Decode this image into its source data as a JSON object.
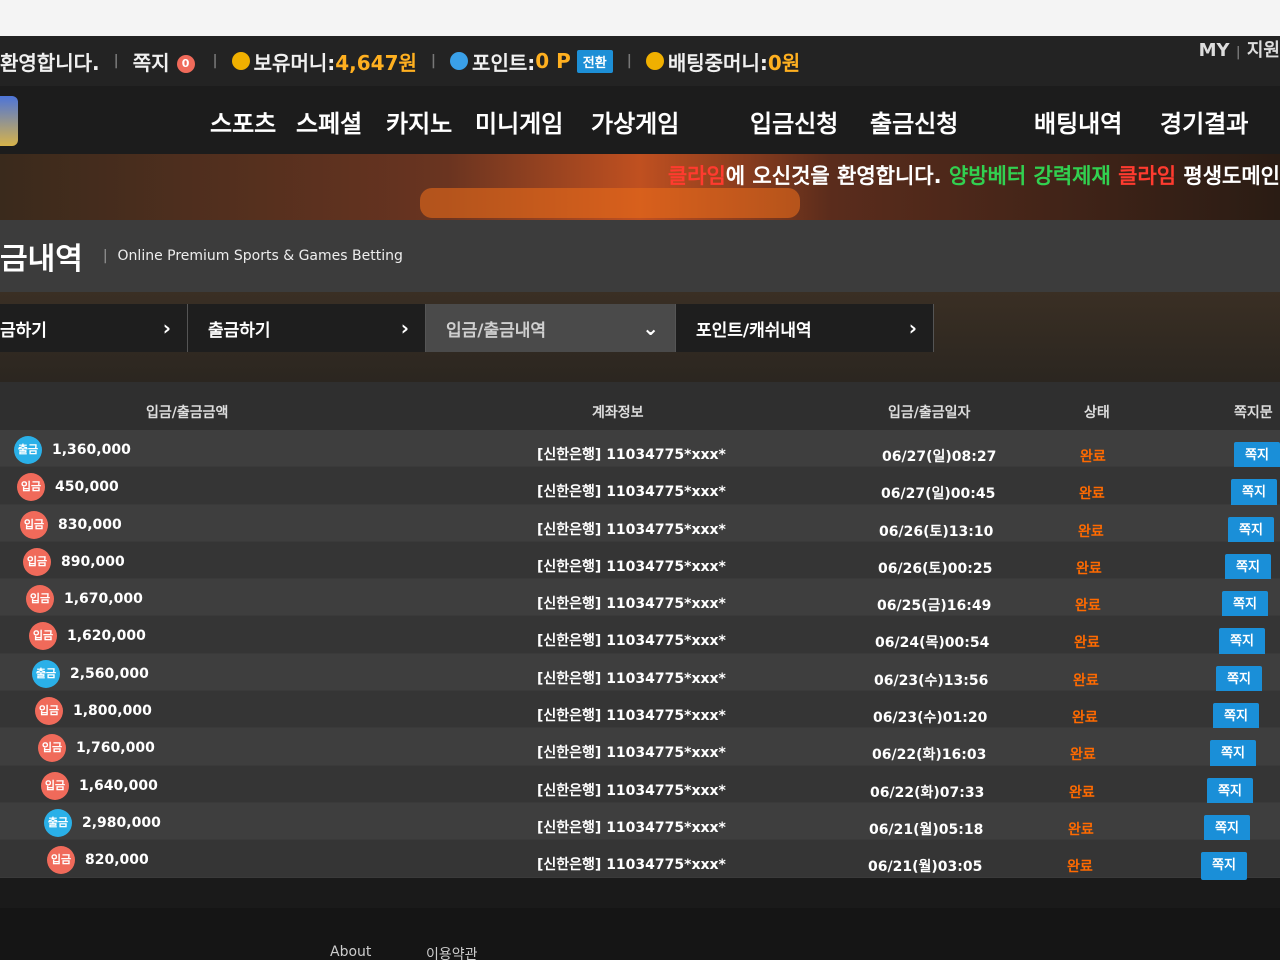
{
  "topbar": {
    "welcome": "환영합니다.",
    "message_label": "쪽지",
    "message_count": "0",
    "balance_label": "보유머니:",
    "balance_value": "4,647원",
    "point_label": "포인트:",
    "point_value": "0 P",
    "convert_label": "전환",
    "betting_label": "배팅중머니:",
    "betting_value": "0원",
    "my_label": "MY",
    "support_label": "지원"
  },
  "nav": {
    "sports": "스포츠",
    "special": "스페셜",
    "casino": "카지노",
    "minigame": "미니게임",
    "virtual": "가상게임",
    "deposit_request": "입금신청",
    "withdraw_request": "출금신청",
    "bet_history": "배팅내역",
    "results": "경기결과"
  },
  "banner": {
    "brand1": "클라임",
    "text1": "에 오신것을 환영합니다.",
    "text2": " 양방베터 강력제재 ",
    "brand2": "클라임",
    "text3": " 평생도메인"
  },
  "page": {
    "title": "금내역",
    "subtitle": "Online Premium Sports & Games Betting"
  },
  "tabs": [
    {
      "label": "금하기"
    },
    {
      "label": "출금하기"
    },
    {
      "label": "입금/출금내역"
    },
    {
      "label": "포인트/캐쉬내역"
    }
  ],
  "table": {
    "headers": {
      "amount": "입금/출금금액",
      "account": "계좌정보",
      "datetime": "입금/출금일자",
      "status": "상태",
      "message": "쪽지문"
    },
    "rows": [
      {
        "type": "출금",
        "kind": "out",
        "amount": "1,360,000",
        "account": "[신한은행] 11034775*xxx*",
        "date": "06/27(일)08:27",
        "status": "완료",
        "msg": "쪽지"
      },
      {
        "type": "입금",
        "kind": "in",
        "amount": "450,000",
        "account": "[신한은행] 11034775*xxx*",
        "date": "06/27(일)00:45",
        "status": "완료",
        "msg": "쪽지"
      },
      {
        "type": "입금",
        "kind": "in",
        "amount": "830,000",
        "account": "[신한은행] 11034775*xxx*",
        "date": "06/26(토)13:10",
        "status": "완료",
        "msg": "쪽지"
      },
      {
        "type": "입금",
        "kind": "in",
        "amount": "890,000",
        "account": "[신한은행] 11034775*xxx*",
        "date": "06/26(토)00:25",
        "status": "완료",
        "msg": "쪽지"
      },
      {
        "type": "입금",
        "kind": "in",
        "amount": "1,670,000",
        "account": "[신한은행] 11034775*xxx*",
        "date": "06/25(금)16:49",
        "status": "완료",
        "msg": "쪽지"
      },
      {
        "type": "입금",
        "kind": "in",
        "amount": "1,620,000",
        "account": "[신한은행] 11034775*xxx*",
        "date": "06/24(목)00:54",
        "status": "완료",
        "msg": "쪽지"
      },
      {
        "type": "출금",
        "kind": "out",
        "amount": "2,560,000",
        "account": "[신한은행] 11034775*xxx*",
        "date": "06/23(수)13:56",
        "status": "완료",
        "msg": "쪽지"
      },
      {
        "type": "입금",
        "kind": "in",
        "amount": "1,800,000",
        "account": "[신한은행] 11034775*xxx*",
        "date": "06/23(수)01:20",
        "status": "완료",
        "msg": "쪽지"
      },
      {
        "type": "입금",
        "kind": "in",
        "amount": "1,760,000",
        "account": "[신한은행] 11034775*xxx*",
        "date": "06/22(화)16:03",
        "status": "완료",
        "msg": "쪽지"
      },
      {
        "type": "입금",
        "kind": "in",
        "amount": "1,640,000",
        "account": "[신한은행] 11034775*xxx*",
        "date": "06/22(화)07:33",
        "status": "완료",
        "msg": "쪽지"
      },
      {
        "type": "출금",
        "kind": "out",
        "amount": "2,980,000",
        "account": "[신한은행] 11034775*xxx*",
        "date": "06/21(월)05:18",
        "status": "완료",
        "msg": "쪽지"
      },
      {
        "type": "입금",
        "kind": "in",
        "amount": "820,000",
        "account": "[신한은행] 11034775*xxx*",
        "date": "06/21(월)03:05",
        "status": "완료",
        "msg": "쪽지"
      }
    ]
  },
  "footer": {
    "about": "About",
    "terms": "이용약관"
  },
  "colors": {
    "accent_blue": "#1a8fd8",
    "status_orange": "#ff6a00",
    "money_gold": "#ffb020",
    "deposit_badge": "#f06a5a",
    "withdraw_badge": "#2ab0e8"
  }
}
